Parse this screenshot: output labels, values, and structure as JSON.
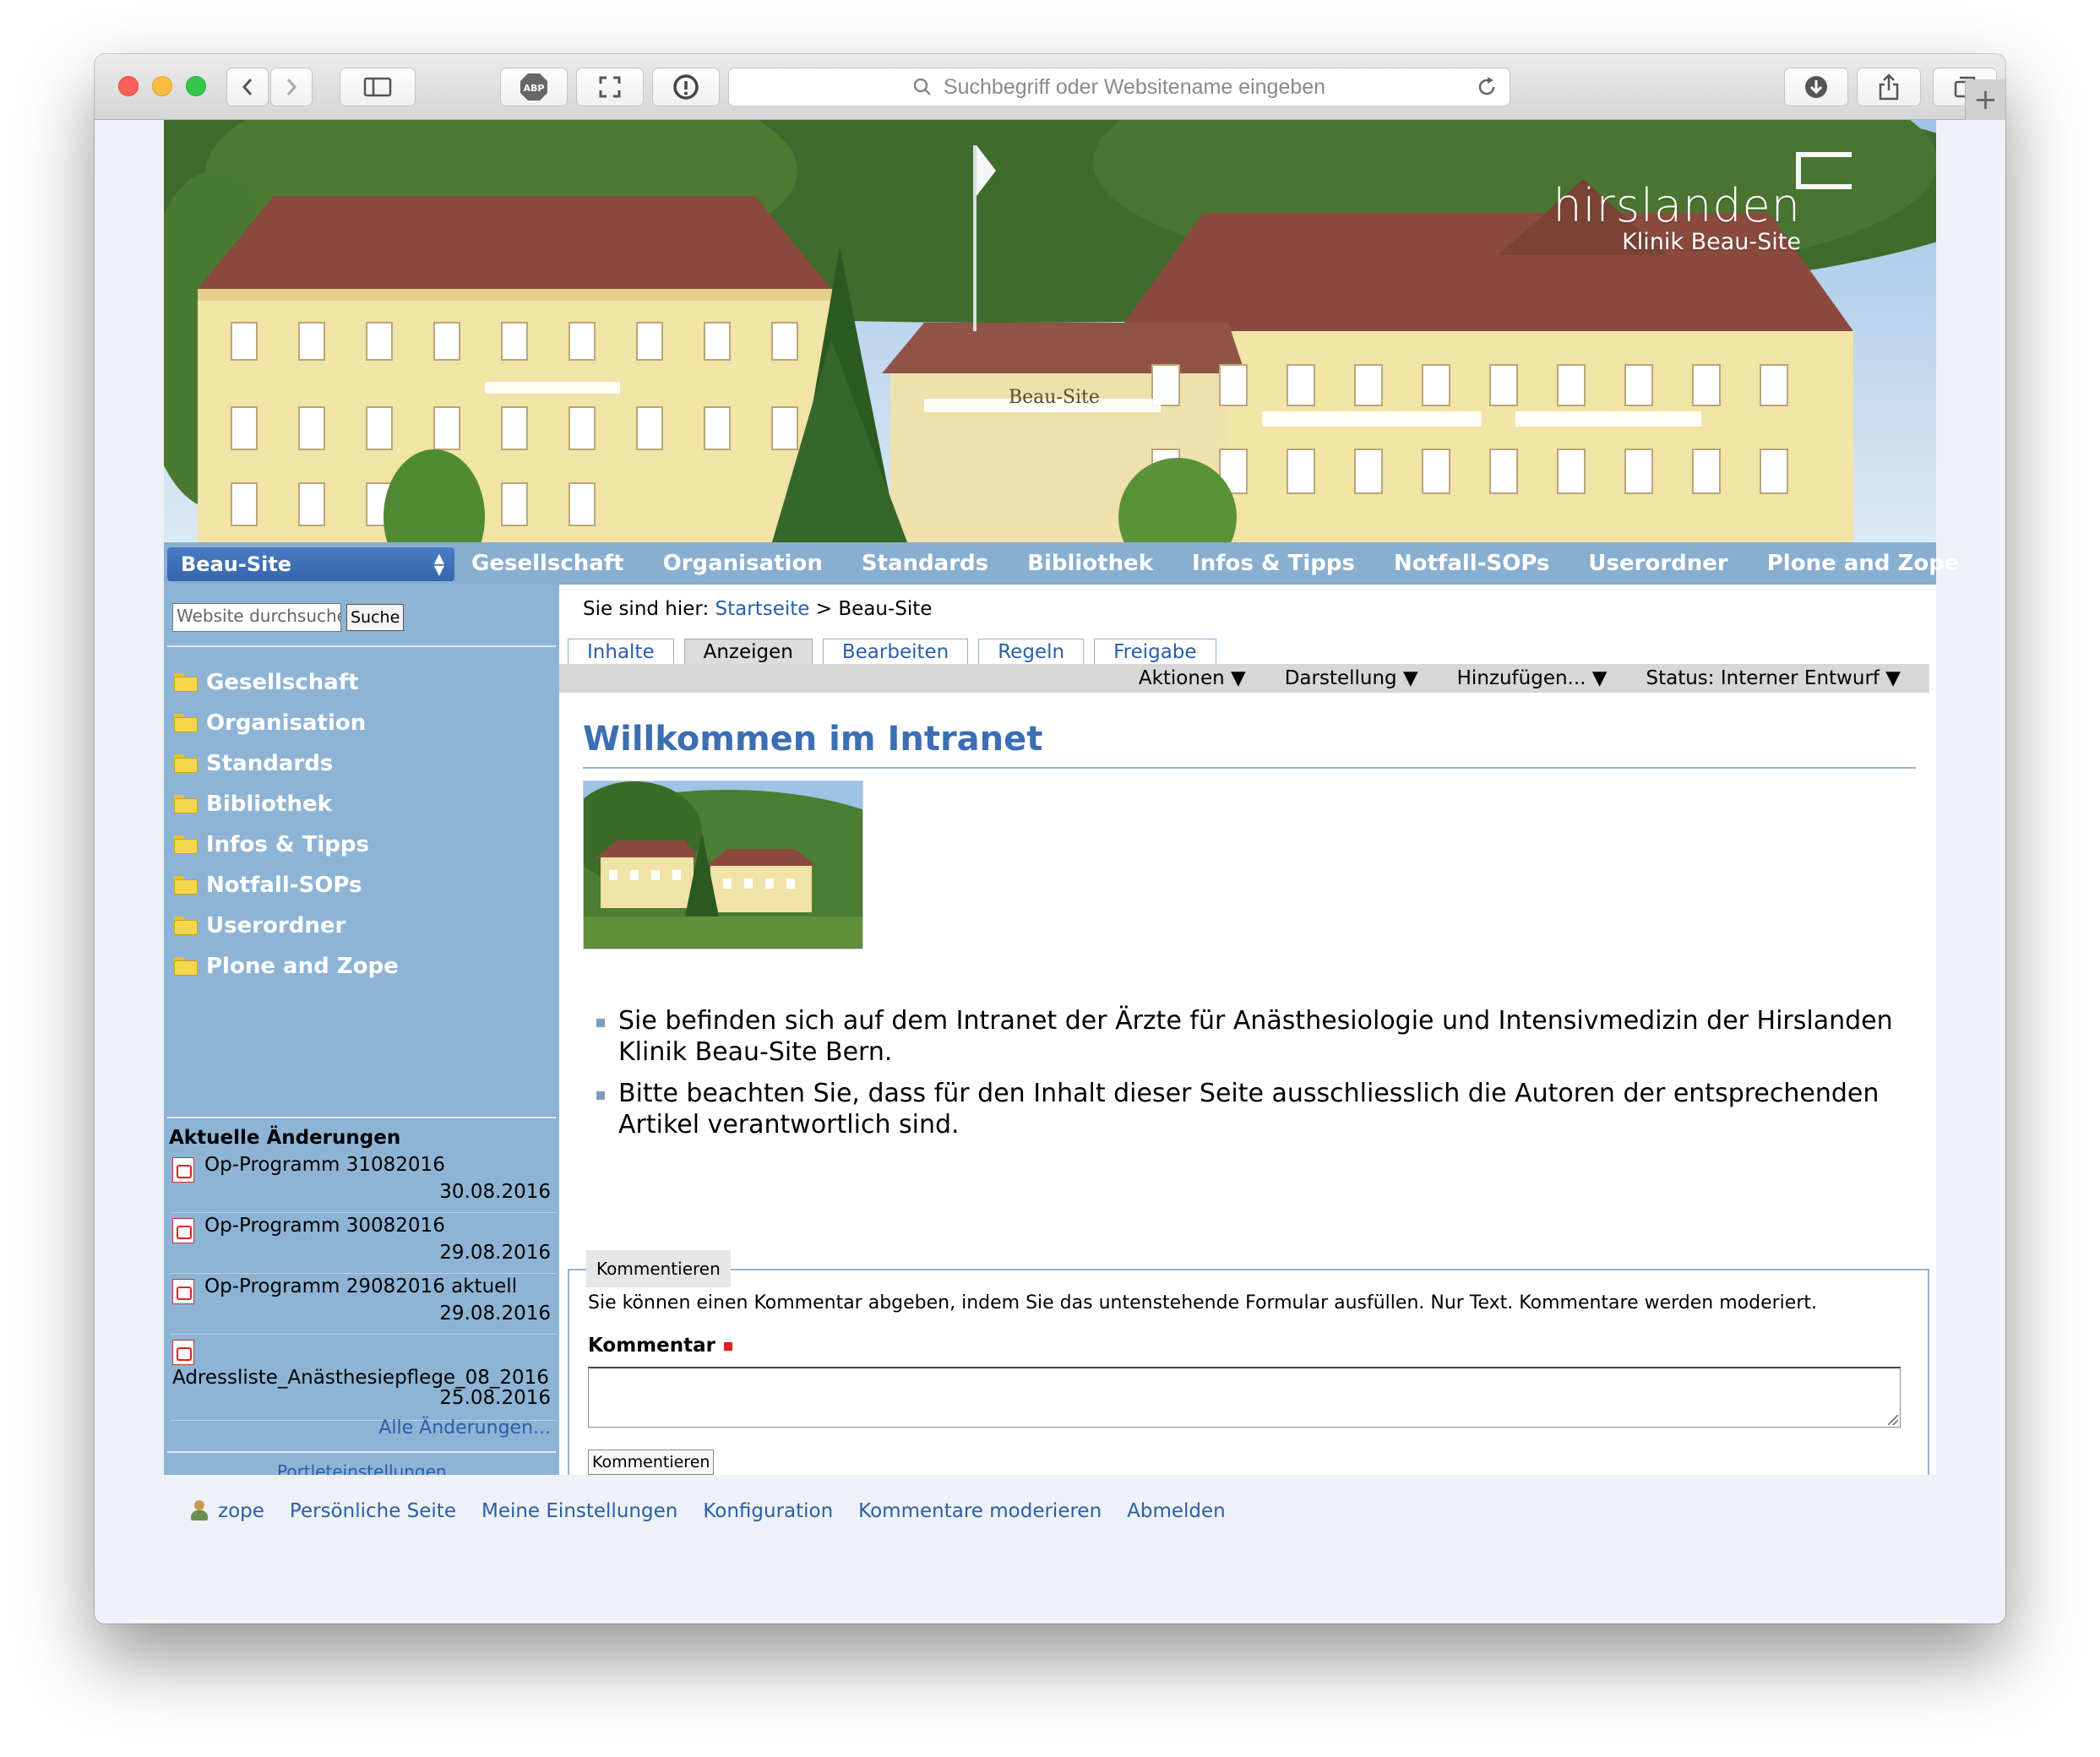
{
  "browser": {
    "url_placeholder": "Suchbegriff oder Websitename eingeben",
    "extension_label": "ABP"
  },
  "banner": {
    "brand_name": "hirslanden",
    "brand_sub": "Klinik Beau-Site",
    "building_sign": "Beau-Site"
  },
  "navbar": {
    "site_select": "Beau-Site",
    "items": [
      "Gesellschaft",
      "Organisation",
      "Standards",
      "Bibliothek",
      "Infos & Tipps",
      "Notfall-SOPs",
      "Userordner",
      "Plone and Zope"
    ]
  },
  "sidebar": {
    "search_placeholder": "Website durchsuchen",
    "search_button": "Suche",
    "folders": [
      "Gesellschaft",
      "Organisation",
      "Standards",
      "Bibliothek",
      "Infos & Tipps",
      "Notfall-SOPs",
      "Userordner",
      "Plone and Zope"
    ],
    "recent_title": "Aktuelle Änderungen",
    "recent": [
      {
        "name": "Op-Programm 31082016",
        "date": "30.08.2016"
      },
      {
        "name": "Op-Programm 30082016",
        "date": "29.08.2016"
      },
      {
        "name": "Op-Programm 29082016 aktuell",
        "date": "29.08.2016"
      },
      {
        "name": "Adressliste_Anästhesiepflege_08_2016",
        "date": "25.08.2016"
      }
    ],
    "all_changes": "Alle Änderungen...",
    "portlet_settings": "Portleteinstellungen"
  },
  "content": {
    "breadcrumb_prefix": "Sie sind hier:",
    "breadcrumb_home": "Startseite",
    "breadcrumb_sep": ">",
    "breadcrumb_current": "Beau-Site",
    "tabs": [
      "Inhalte",
      "Anzeigen",
      "Bearbeiten",
      "Regeln",
      "Freigabe"
    ],
    "active_tab": "Anzeigen",
    "actions": [
      "Aktionen ▼",
      "Darstellung ▼",
      "Hinzufügen... ▼",
      "Status: Interner Entwurf ▼"
    ],
    "title": "Willkommen im Intranet",
    "bullets": [
      "Sie befinden sich auf dem Intranet der Ärzte für Anästhesiologie und Intensivmedizin der Hirslanden Klinik Beau-Site Bern.",
      "Bitte beachten Sie, dass für den Inhalt dieser Seite ausschliesslich die Autoren der entsprechenden Artikel verantwortlich sind."
    ],
    "comment_legend": "Kommentieren",
    "comment_desc": "Sie können einen Kommentar abgeben, indem Sie das untenstehende Formular ausfüllen. Nur Text. Kommentare werden moderiert.",
    "comment_label": "Kommentar",
    "comment_submit": "Kommentieren"
  },
  "footer": {
    "user": "zope",
    "links": [
      "Persönliche Seite",
      "Meine Einstellungen",
      "Konfiguration",
      "Kommentare moderieren",
      "Abmelden"
    ]
  },
  "colors": {
    "nav_blue": "#88aed0",
    "link_blue": "#2a5ea8",
    "title_blue": "#3b6eb4",
    "select_blue": "#3465ad"
  }
}
